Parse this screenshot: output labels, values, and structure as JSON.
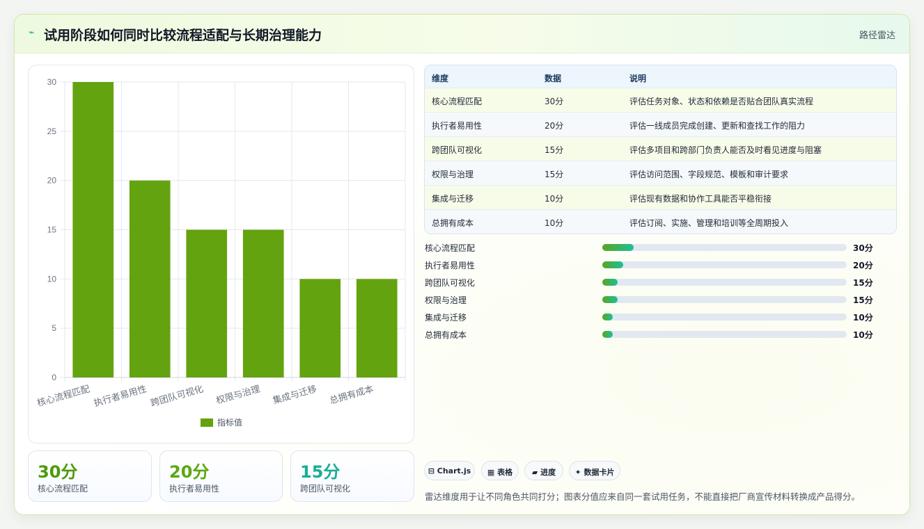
{
  "header": {
    "logo_icon": "⌁",
    "title": "试用阶段如何同时比较流程适配与长期治理能力",
    "tag": "路径雷达"
  },
  "chart_data": {
    "type": "bar",
    "categories": [
      "核心流程匹配",
      "执行者易用性",
      "跨团队可视化",
      "权限与治理",
      "集成与迁移",
      "总拥有成本"
    ],
    "series": [
      {
        "name": "指标值",
        "values": [
          30,
          20,
          15,
          15,
          10,
          10
        ],
        "color": "#63a30f"
      }
    ],
    "ylim": [
      0,
      30
    ],
    "yticks": [
      0,
      5,
      10,
      15,
      20,
      25,
      30
    ],
    "grid": true,
    "legend": "bottom"
  },
  "kpis": [
    {
      "value": "30分",
      "label": "核心流程匹配",
      "color": "#4d9a08"
    },
    {
      "value": "20分",
      "label": "执行者易用性",
      "color": "#5aa80f"
    },
    {
      "value": "15分",
      "label": "跨团队可视化",
      "color": "#19ae95"
    }
  ],
  "table": {
    "headers": [
      "维度",
      "数据",
      "说明"
    ],
    "rows": [
      [
        "核心流程匹配",
        "30分",
        "评估任务对象、状态和依赖是否贴合团队真实流程"
      ],
      [
        "执行者易用性",
        "20分",
        "评估一线成员完成创建、更新和查找工作的阻力"
      ],
      [
        "跨团队可视化",
        "15分",
        "评估多项目和跨部门负责人能否及时看见进度与阻塞"
      ],
      [
        "权限与治理",
        "15分",
        "评估访问范围、字段规范、模板和审计要求"
      ],
      [
        "集成与迁移",
        "10分",
        "评估现有数据和协作工具能否平稳衔接"
      ],
      [
        "总拥有成本",
        "10分",
        "评估订阅、实施、管理和培训等全周期投入"
      ]
    ]
  },
  "progress": [
    {
      "label": "核心流程匹配",
      "value": "30分",
      "fraction": 0.128
    },
    {
      "label": "执行者易用性",
      "value": "20分",
      "fraction": 0.085
    },
    {
      "label": "跨团队可视化",
      "value": "15分",
      "fraction": 0.064
    },
    {
      "label": "权限与治理",
      "value": "15分",
      "fraction": 0.064
    },
    {
      "label": "集成与迁移",
      "value": "10分",
      "fraction": 0.043
    },
    {
      "label": "总拥有成本",
      "value": "10分",
      "fraction": 0.043
    }
  ],
  "chips": [
    {
      "icon": "⊟",
      "label": "Chart.js"
    },
    {
      "icon": "▦",
      "label": "表格"
    },
    {
      "icon": "▰",
      "label": "进度"
    },
    {
      "icon": "✦",
      "label": "数据卡片"
    }
  ],
  "note": "雷达维度用于让不同角色共同打分；图表分值应来自同一套试用任务，不能直接把厂商宣传材料转换成产品得分。"
}
